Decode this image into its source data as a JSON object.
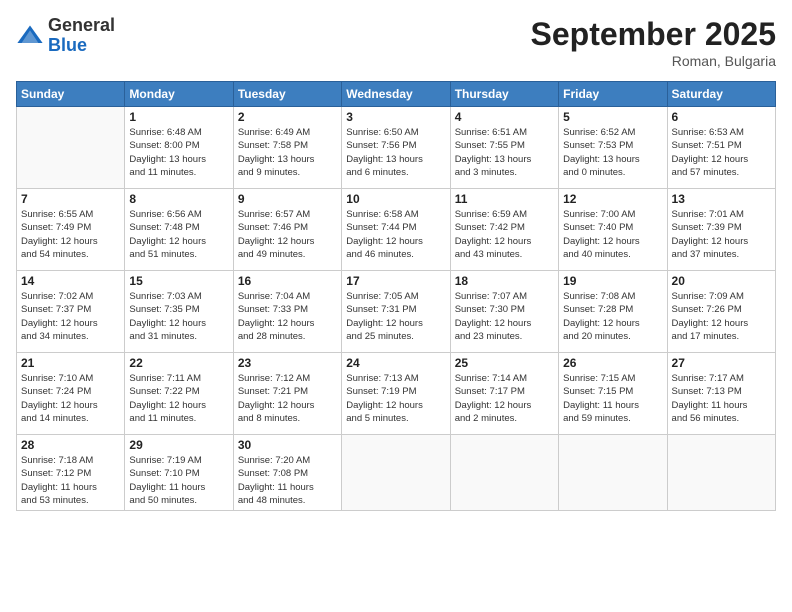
{
  "logo": {
    "general": "General",
    "blue": "Blue"
  },
  "title": "September 2025",
  "location": "Roman, Bulgaria",
  "days_header": [
    "Sunday",
    "Monday",
    "Tuesday",
    "Wednesday",
    "Thursday",
    "Friday",
    "Saturday"
  ],
  "weeks": [
    [
      {
        "day": "",
        "info": ""
      },
      {
        "day": "1",
        "info": "Sunrise: 6:48 AM\nSunset: 8:00 PM\nDaylight: 13 hours\nand 11 minutes."
      },
      {
        "day": "2",
        "info": "Sunrise: 6:49 AM\nSunset: 7:58 PM\nDaylight: 13 hours\nand 9 minutes."
      },
      {
        "day": "3",
        "info": "Sunrise: 6:50 AM\nSunset: 7:56 PM\nDaylight: 13 hours\nand 6 minutes."
      },
      {
        "day": "4",
        "info": "Sunrise: 6:51 AM\nSunset: 7:55 PM\nDaylight: 13 hours\nand 3 minutes."
      },
      {
        "day": "5",
        "info": "Sunrise: 6:52 AM\nSunset: 7:53 PM\nDaylight: 13 hours\nand 0 minutes."
      },
      {
        "day": "6",
        "info": "Sunrise: 6:53 AM\nSunset: 7:51 PM\nDaylight: 12 hours\nand 57 minutes."
      }
    ],
    [
      {
        "day": "7",
        "info": "Sunrise: 6:55 AM\nSunset: 7:49 PM\nDaylight: 12 hours\nand 54 minutes."
      },
      {
        "day": "8",
        "info": "Sunrise: 6:56 AM\nSunset: 7:48 PM\nDaylight: 12 hours\nand 51 minutes."
      },
      {
        "day": "9",
        "info": "Sunrise: 6:57 AM\nSunset: 7:46 PM\nDaylight: 12 hours\nand 49 minutes."
      },
      {
        "day": "10",
        "info": "Sunrise: 6:58 AM\nSunset: 7:44 PM\nDaylight: 12 hours\nand 46 minutes."
      },
      {
        "day": "11",
        "info": "Sunrise: 6:59 AM\nSunset: 7:42 PM\nDaylight: 12 hours\nand 43 minutes."
      },
      {
        "day": "12",
        "info": "Sunrise: 7:00 AM\nSunset: 7:40 PM\nDaylight: 12 hours\nand 40 minutes."
      },
      {
        "day": "13",
        "info": "Sunrise: 7:01 AM\nSunset: 7:39 PM\nDaylight: 12 hours\nand 37 minutes."
      }
    ],
    [
      {
        "day": "14",
        "info": "Sunrise: 7:02 AM\nSunset: 7:37 PM\nDaylight: 12 hours\nand 34 minutes."
      },
      {
        "day": "15",
        "info": "Sunrise: 7:03 AM\nSunset: 7:35 PM\nDaylight: 12 hours\nand 31 minutes."
      },
      {
        "day": "16",
        "info": "Sunrise: 7:04 AM\nSunset: 7:33 PM\nDaylight: 12 hours\nand 28 minutes."
      },
      {
        "day": "17",
        "info": "Sunrise: 7:05 AM\nSunset: 7:31 PM\nDaylight: 12 hours\nand 25 minutes."
      },
      {
        "day": "18",
        "info": "Sunrise: 7:07 AM\nSunset: 7:30 PM\nDaylight: 12 hours\nand 23 minutes."
      },
      {
        "day": "19",
        "info": "Sunrise: 7:08 AM\nSunset: 7:28 PM\nDaylight: 12 hours\nand 20 minutes."
      },
      {
        "day": "20",
        "info": "Sunrise: 7:09 AM\nSunset: 7:26 PM\nDaylight: 12 hours\nand 17 minutes."
      }
    ],
    [
      {
        "day": "21",
        "info": "Sunrise: 7:10 AM\nSunset: 7:24 PM\nDaylight: 12 hours\nand 14 minutes."
      },
      {
        "day": "22",
        "info": "Sunrise: 7:11 AM\nSunset: 7:22 PM\nDaylight: 12 hours\nand 11 minutes."
      },
      {
        "day": "23",
        "info": "Sunrise: 7:12 AM\nSunset: 7:21 PM\nDaylight: 12 hours\nand 8 minutes."
      },
      {
        "day": "24",
        "info": "Sunrise: 7:13 AM\nSunset: 7:19 PM\nDaylight: 12 hours\nand 5 minutes."
      },
      {
        "day": "25",
        "info": "Sunrise: 7:14 AM\nSunset: 7:17 PM\nDaylight: 12 hours\nand 2 minutes."
      },
      {
        "day": "26",
        "info": "Sunrise: 7:15 AM\nSunset: 7:15 PM\nDaylight: 11 hours\nand 59 minutes."
      },
      {
        "day": "27",
        "info": "Sunrise: 7:17 AM\nSunset: 7:13 PM\nDaylight: 11 hours\nand 56 minutes."
      }
    ],
    [
      {
        "day": "28",
        "info": "Sunrise: 7:18 AM\nSunset: 7:12 PM\nDaylight: 11 hours\nand 53 minutes."
      },
      {
        "day": "29",
        "info": "Sunrise: 7:19 AM\nSunset: 7:10 PM\nDaylight: 11 hours\nand 50 minutes."
      },
      {
        "day": "30",
        "info": "Sunrise: 7:20 AM\nSunset: 7:08 PM\nDaylight: 11 hours\nand 48 minutes."
      },
      {
        "day": "",
        "info": ""
      },
      {
        "day": "",
        "info": ""
      },
      {
        "day": "",
        "info": ""
      },
      {
        "day": "",
        "info": ""
      }
    ]
  ]
}
